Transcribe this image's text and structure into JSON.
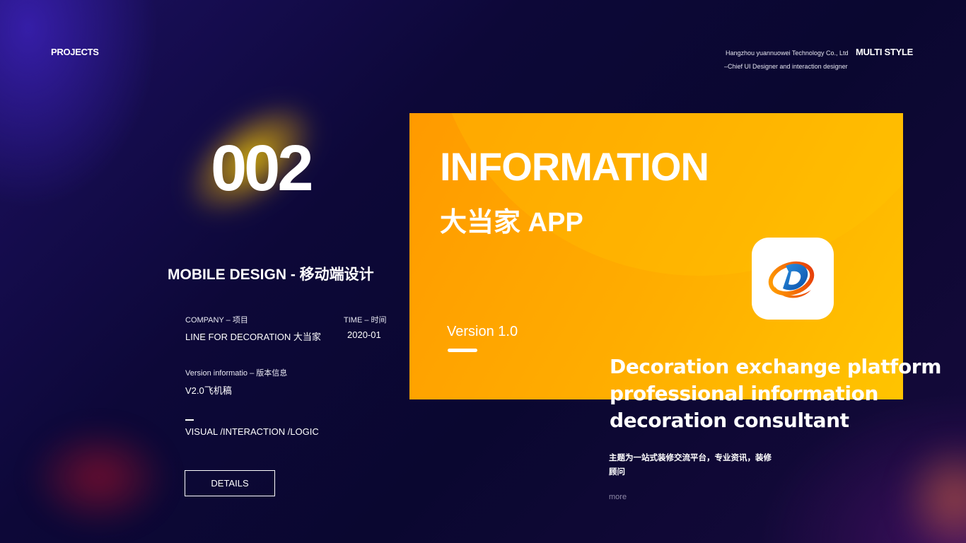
{
  "header": {
    "projects_label": "PROJECTS",
    "company_name": "Hangzhou yuannuowei Technology Co., Ltd",
    "role": "–Chief UI Designer and interaction designer",
    "style_label": "MULTI STYLE"
  },
  "project": {
    "number": "002",
    "title": "MOBILE  DESIGN - 移动端设计",
    "company_label": "COMPANY – 项目",
    "company_value": "LINE FOR DECORATION  大当家",
    "time_label": "TIME – 时间",
    "time_value": "2020-01",
    "version_label": "Version informatio – 版本信息",
    "version_value": "V2.0飞机稿",
    "scope": "VISUAL /INTERACTION /LOGIC",
    "details_button": "DETAILS"
  },
  "card": {
    "title": "INFORMATION",
    "subtitle": "大当家 APP",
    "version": "Version 1.0",
    "colors": {
      "gradient_start": "#ff9a00",
      "gradient_end": "#ffc400"
    },
    "app_icon": "app-logo-icon"
  },
  "description": {
    "line1": "Decoration exchange platform",
    "line2": "professional information",
    "line3": "decoration consultant",
    "cn_text": "主题为一站式装修交流平台，专业资讯，装修顾问",
    "more_link": "more"
  }
}
